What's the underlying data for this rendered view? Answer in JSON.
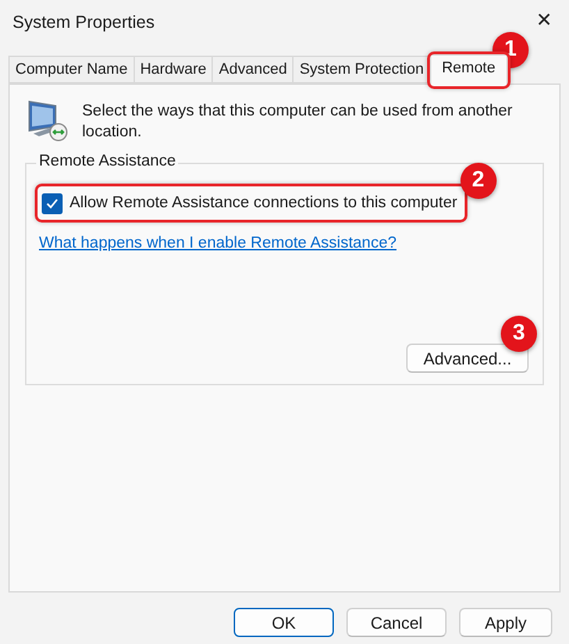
{
  "window": {
    "title": "System Properties",
    "close": "✕"
  },
  "tabs": [
    {
      "label": "Computer Name",
      "selected": false,
      "highlighted": false
    },
    {
      "label": "Hardware",
      "selected": false,
      "highlighted": false
    },
    {
      "label": "Advanced",
      "selected": false,
      "highlighted": false
    },
    {
      "label": "System Protection",
      "selected": false,
      "highlighted": false
    },
    {
      "label": "Remote",
      "selected": true,
      "highlighted": true
    }
  ],
  "remote": {
    "intro": "Select the ways that this computer can be used from another location.",
    "remote_assistance": {
      "title": "Remote Assistance",
      "allow": {
        "label": "Allow Remote Assistance connections to this computer",
        "checked": true,
        "highlighted": true
      },
      "help_link": "What happens when I enable Remote Assistance?",
      "advanced_button": "Advanced..."
    }
  },
  "buttons": [
    {
      "label": "OK",
      "default": true
    },
    {
      "label": "Cancel",
      "default": false
    },
    {
      "label": "Apply",
      "default": false
    }
  ],
  "callouts": [
    {
      "number": "1"
    },
    {
      "number": "2"
    },
    {
      "number": "3"
    }
  ]
}
